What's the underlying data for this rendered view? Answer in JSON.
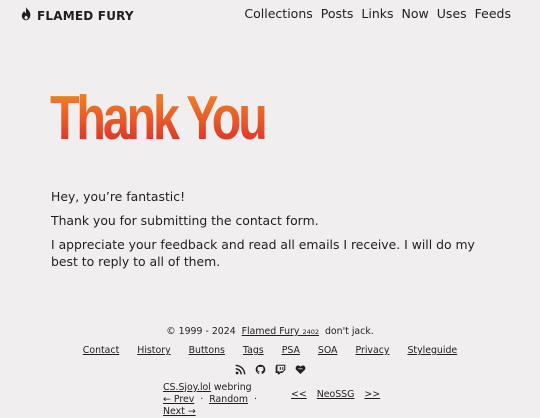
{
  "header": {
    "brand": "FLAMED FURY",
    "nav": [
      "Collections",
      "Posts",
      "Links",
      "Now",
      "Uses",
      "Feeds"
    ]
  },
  "main": {
    "title": "Thank You",
    "paragraphs": [
      "Hey, you’re fantastic!",
      "Thank you for submitting the contact form.",
      "I appreciate your feedback and read all emails I receive. I will do my best to reply to all of them."
    ]
  },
  "footer": {
    "copyright_prefix": "© 1999 - 2024",
    "site_name": "Flamed Fury",
    "site_number": "2402",
    "tagline": "don't jack.",
    "links": [
      "Contact",
      "History",
      "Buttons",
      "Tags",
      "PSA",
      "SOA",
      "Privacy",
      "Styleguide"
    ],
    "social_icons": [
      "rss-icon",
      "github-icon",
      "twitch-icon",
      "heart-icon"
    ],
    "webring1_name": "CS.Sjoy.lol",
    "webring1_label": "webring",
    "webring1_prev": "← Prev",
    "webring1_random": "Random",
    "webring1_next": "Next →",
    "webring2_prev": "<<",
    "webring2_name": "NeoSSG",
    "webring2_next": ">>"
  },
  "colors": {
    "background": "#f0eeee",
    "text": "#1f1f1f",
    "title_gradient": [
      "#f08a23",
      "#e8552a",
      "#d8262b"
    ]
  }
}
